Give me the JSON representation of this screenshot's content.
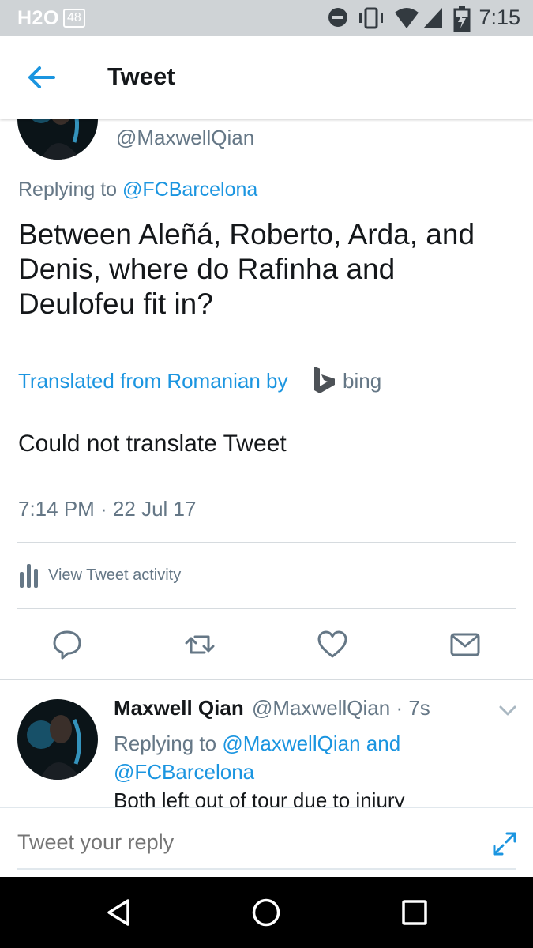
{
  "status_bar": {
    "carrier": "H2O",
    "badge": "48",
    "time": "7:15"
  },
  "app_bar": {
    "title": "Tweet"
  },
  "main_tweet": {
    "handle": "@MaxwellQian",
    "replying_prefix": "Replying to ",
    "replying_to": "@FCBarcelona",
    "text": "Between Aleñá, Roberto, Arda, and Denis, where do Rafinha and Deulofeu fit in?",
    "translated_label": "Translated from Romanian by",
    "translator_name": "bing",
    "translation_result": "Could not translate Tweet",
    "timestamp": "7:14 PM · 22 Jul 17",
    "activity_label": "View Tweet activity"
  },
  "reply_tweet": {
    "name": "Maxwell Qian",
    "handle_time": "@MaxwellQian · 7s",
    "replying_prefix": "Replying to ",
    "replying_to_1": "@MaxwellQian",
    "replying_and": " and",
    "replying_to_2": "@FCBarcelona",
    "text": "Both left out of tour due to injury"
  },
  "composer": {
    "placeholder": "Tweet your reply"
  },
  "colors": {
    "accent": "#1b95e0",
    "muted": "#657786",
    "text": "#14171a",
    "status_bar": "#cfd3d6"
  }
}
